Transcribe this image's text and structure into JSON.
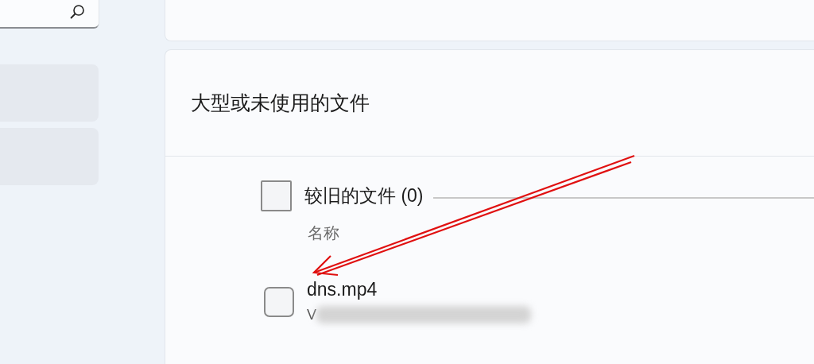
{
  "sidebar": {
    "search": {
      "kind": "search"
    },
    "items": [
      {
        "selected": false
      },
      {
        "selected": false
      }
    ]
  },
  "section": {
    "title": "大型或未使用的文件",
    "group": {
      "label": "较旧的文件 (0)",
      "checked": false,
      "column_header": "名称",
      "files": [
        {
          "name": "dns.mp4",
          "path": "V",
          "checked": false
        }
      ]
    }
  },
  "annotation": {
    "kind": "arrow"
  }
}
